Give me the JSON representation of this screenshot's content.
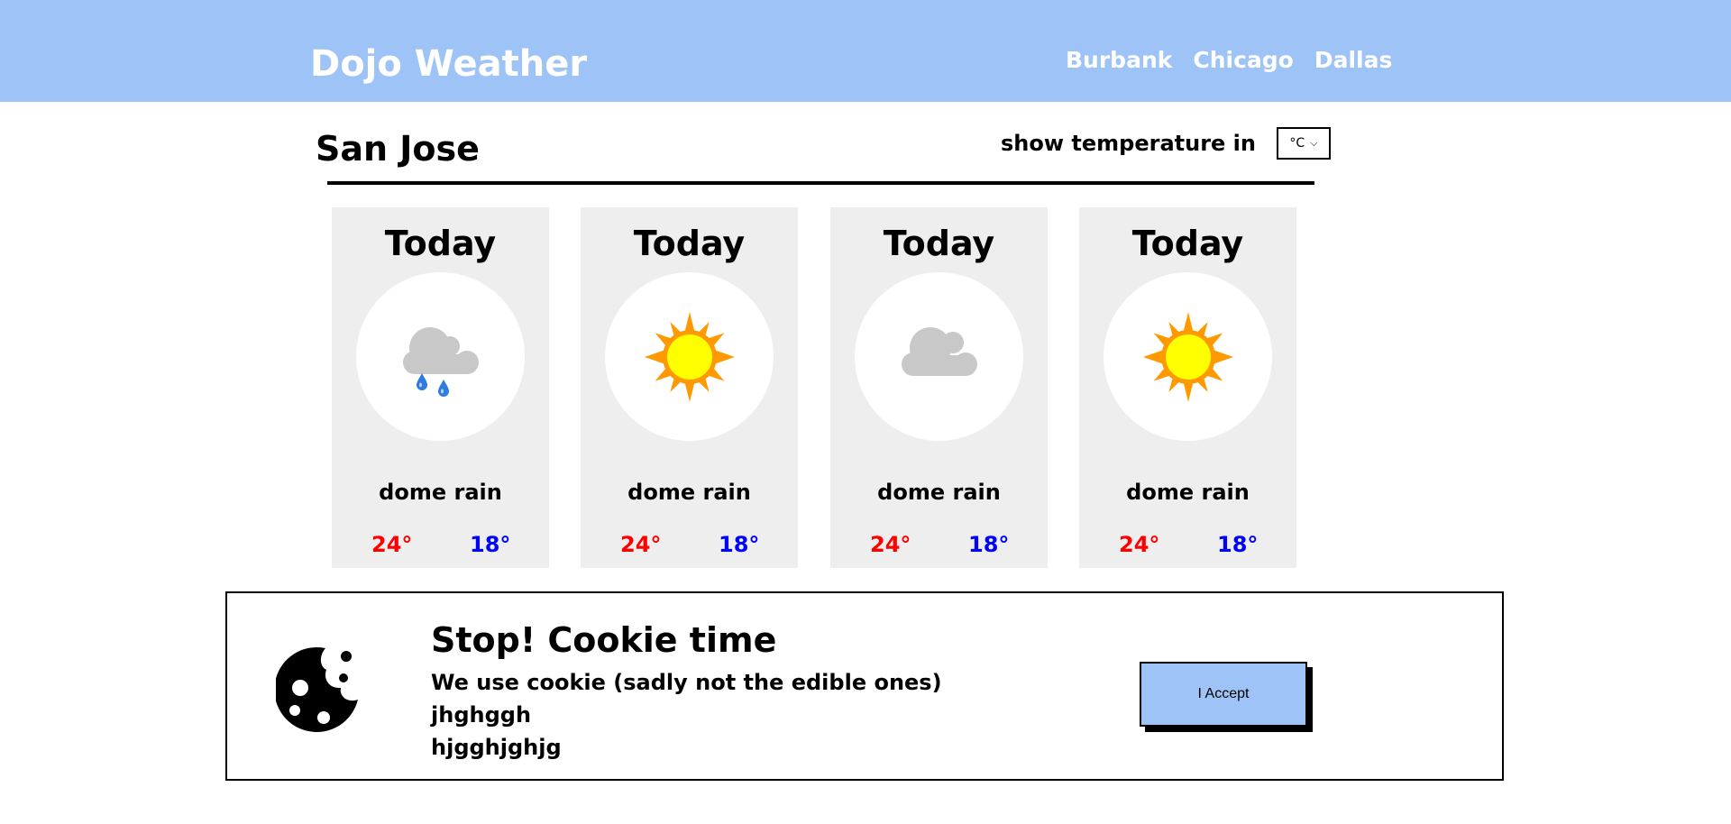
{
  "header": {
    "brand": "Dojo Weather",
    "nav": [
      "Burbank",
      "Chicago",
      "Dallas"
    ]
  },
  "main": {
    "city": "San Jose",
    "unit_label": "show temperature in",
    "unit_selected": "°C",
    "cards": [
      {
        "day": "Today",
        "icon": "rain-cloud-icon",
        "desc": "dome rain",
        "high": "24°",
        "low": "18°"
      },
      {
        "day": "Today",
        "icon": "sun-icon",
        "desc": "dome rain",
        "high": "24°",
        "low": "18°"
      },
      {
        "day": "Today",
        "icon": "cloud-icon",
        "desc": "dome rain",
        "high": "24°",
        "low": "18°"
      },
      {
        "day": "Today",
        "icon": "sun-icon",
        "desc": "dome rain",
        "high": "24°",
        "low": "18°"
      }
    ]
  },
  "cookie": {
    "title": "Stop! Cookie time",
    "lines": [
      "We use cookie (sadly not the edible ones)",
      "jhghggh",
      "hjgghjghjg"
    ],
    "accept_label": "I Accept",
    "icon": "cookie-icon"
  },
  "colors": {
    "header_bg": "#9ec3f6",
    "card_bg": "#eeeeee",
    "high_temp": "#ff0000",
    "low_temp": "#0000ff",
    "sun_rays": "#ff9900",
    "sun_core": "#ffff00",
    "cloud": "#c8c8c8",
    "raindrop": "#2f7be0"
  }
}
